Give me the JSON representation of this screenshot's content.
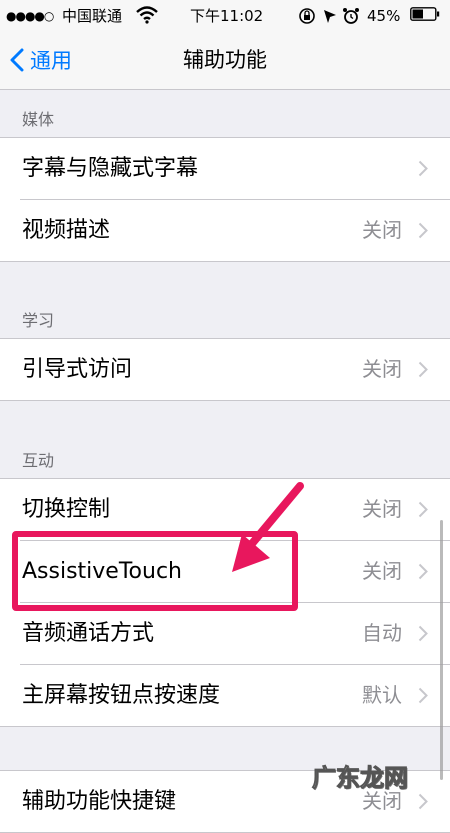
{
  "status_bar": {
    "signal": "●●●●○",
    "carrier": "中国联通",
    "time": "下午11:02",
    "battery_percent": "45%",
    "icons": [
      "wifi-icon",
      "lock-rotation-icon",
      "location-icon",
      "alarm-icon",
      "battery-icon"
    ]
  },
  "nav": {
    "back_label": "通用",
    "title": "辅助功能"
  },
  "sections": [
    {
      "header": "媒体",
      "rows": [
        {
          "label": "字幕与隐藏式字幕",
          "value": ""
        },
        {
          "label": "视频描述",
          "value": "关闭"
        }
      ]
    },
    {
      "header": "学习",
      "rows": [
        {
          "label": "引导式访问",
          "value": "关闭"
        }
      ]
    },
    {
      "header": "互动",
      "rows": [
        {
          "label": "切换控制",
          "value": "关闭"
        },
        {
          "label": "AssistiveTouch",
          "value": "关闭"
        },
        {
          "label": "音频通话方式",
          "value": "自动"
        },
        {
          "label": "主屏幕按钮点按速度",
          "value": "默认"
        }
      ]
    },
    {
      "header": "",
      "rows": [
        {
          "label": "辅助功能快捷键",
          "value": "关闭"
        }
      ]
    }
  ],
  "annotation": {
    "highlight_color": "#e8175d",
    "target": "AssistiveTouch"
  },
  "watermark": "广东龙网",
  "colors": {
    "accent": "#007aff",
    "background": "#efeff4",
    "secondary_text": "#8e8e93"
  }
}
